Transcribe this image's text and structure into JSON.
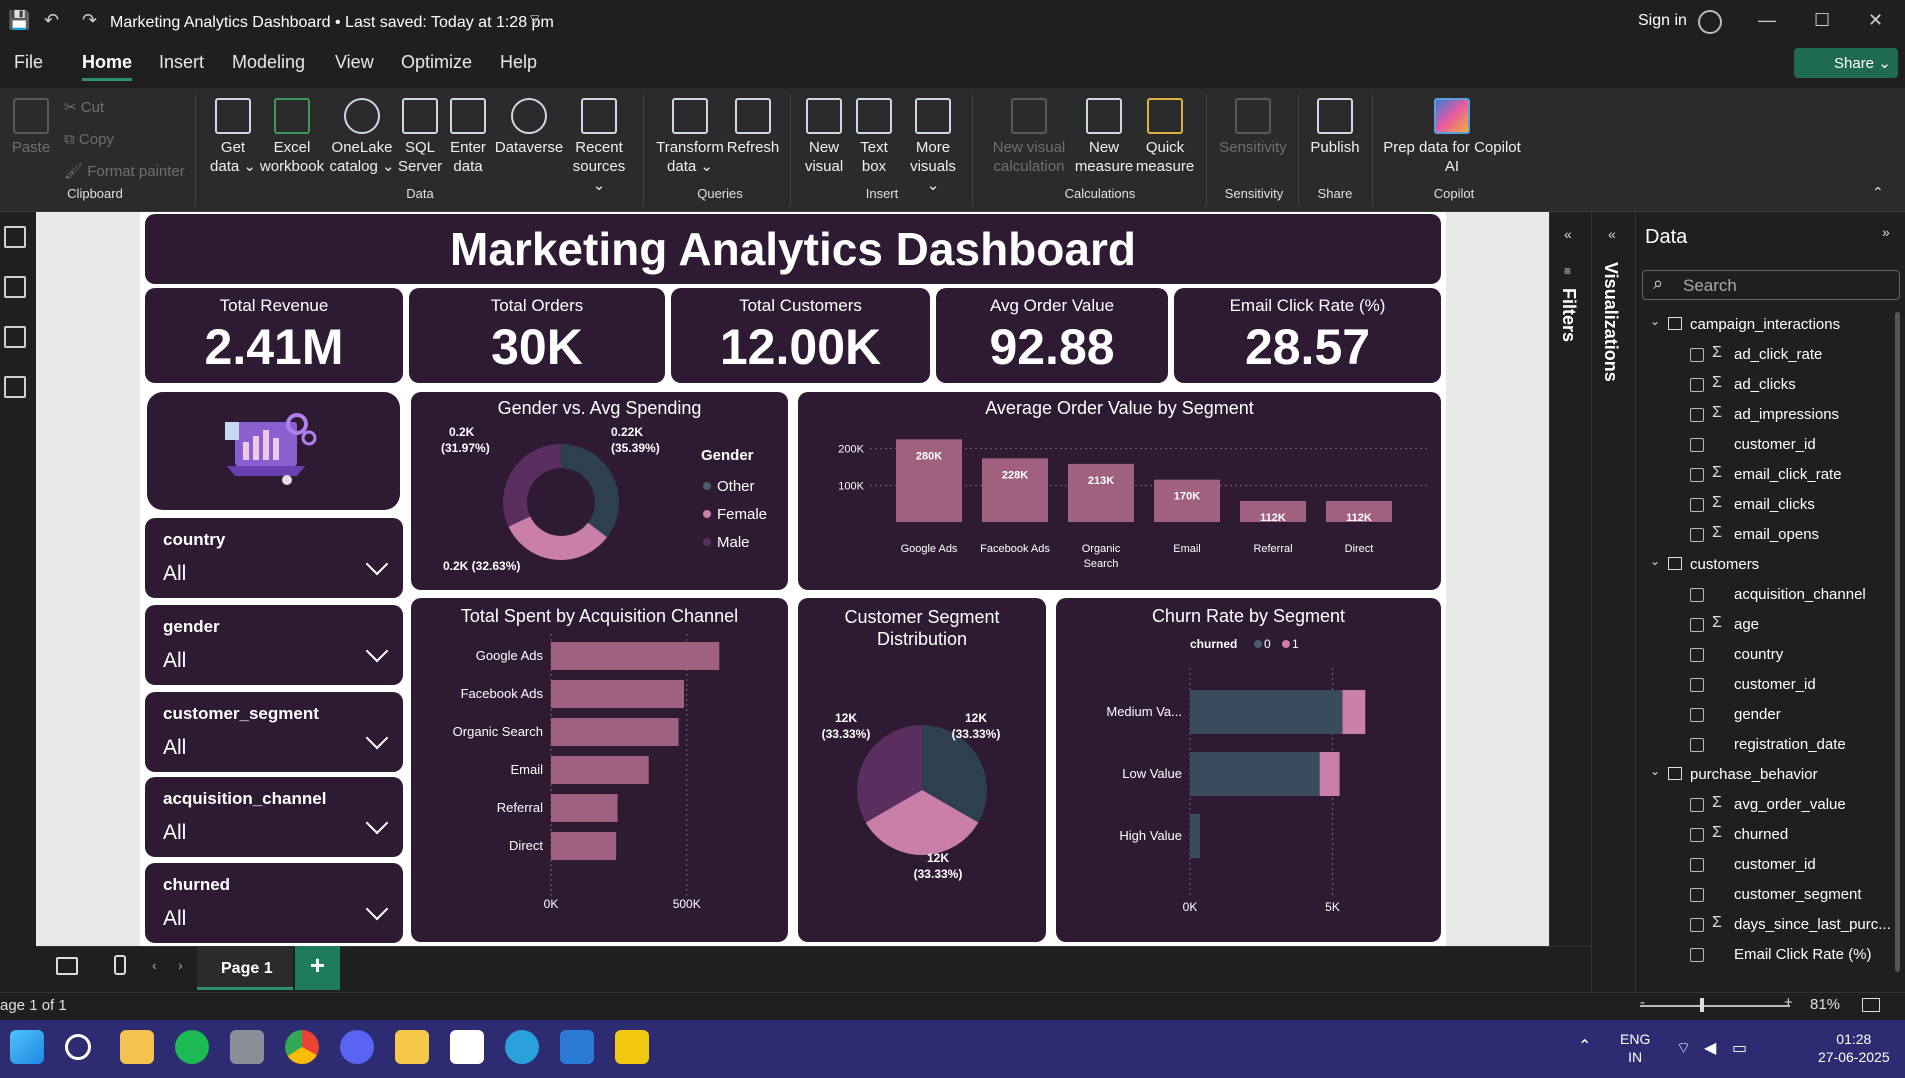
{
  "window": {
    "title": "Marketing Analytics Dashboard • Last saved: Today at 1:28 pm",
    "sign_in": "Sign in"
  },
  "menu": [
    "File",
    "Home",
    "Insert",
    "Modeling",
    "View",
    "Optimize",
    "Help"
  ],
  "share_label": "Share",
  "ribbon": {
    "clipboard": {
      "paste": "Paste",
      "cut": "Cut",
      "copy": "Copy",
      "format_painter": "Format painter",
      "group": "Clipboard"
    },
    "data": {
      "get_data": "Get data",
      "excel": "Excel workbook",
      "onelake": "OneLake catalog",
      "sql": "SQL Server",
      "enter": "Enter data",
      "dataverse": "Dataverse",
      "recent": "Recent sources",
      "group": "Data"
    },
    "queries": {
      "transform": "Transform data",
      "refresh": "Refresh",
      "group": "Queries"
    },
    "insert": {
      "new_visual": "New visual",
      "text_box": "Text box",
      "more_visuals": "More visuals",
      "group": "Insert"
    },
    "calculations": {
      "new_visual_calc": "New visual calculation",
      "new_measure": "New measure",
      "quick_measure": "Quick measure",
      "group": "Calculations"
    },
    "sensitivity": {
      "label": "Sensitivity",
      "group": "Sensitivity"
    },
    "share": {
      "publish": "Publish",
      "group": "Share"
    },
    "copilot": {
      "prep": "Prep data for Copilot AI",
      "copilot": "Copilot",
      "group": "Copilot"
    }
  },
  "report": {
    "title": "Marketing Analytics Dashboard",
    "kpis": [
      {
        "label": "Total Revenue",
        "value": "2.41M"
      },
      {
        "label": "Total Orders",
        "value": "30K"
      },
      {
        "label": "Total Customers",
        "value": "12.00K"
      },
      {
        "label": "Avg Order Value",
        "value": "92.88"
      },
      {
        "label": "Email Click Rate (%)",
        "value": "28.57"
      }
    ],
    "slicers": [
      {
        "label": "country",
        "value": "All"
      },
      {
        "label": "gender",
        "value": "All"
      },
      {
        "label": "customer_segment",
        "value": "All"
      },
      {
        "label": "acquisition_channel",
        "value": "All"
      },
      {
        "label": "churned",
        "value": "All"
      }
    ]
  },
  "colors": {
    "card": "#2e1a33",
    "pink": "#c97fa9",
    "dark_slate": "#2e3f4f",
    "plum": "#5a2e5e",
    "bar": "#a0607f"
  },
  "chart_data": [
    {
      "type": "pie",
      "title": "Gender vs. Avg Spending",
      "legend_title": "Gender",
      "legend_placement": "right",
      "slices": [
        {
          "name": "Other",
          "label": "0.22K",
          "pct": "(35.39%)",
          "value": 35.39,
          "color": "#2e3f4f"
        },
        {
          "name": "Female",
          "label": "0.2K",
          "pct": "(32.63%)",
          "value": 32.63,
          "color": "#c97fa9"
        },
        {
          "name": "Male",
          "label": "0.2K",
          "pct": "(31.97%)",
          "value": 31.97,
          "color": "#5a2e5e"
        }
      ],
      "donut": true
    },
    {
      "type": "bar",
      "title": "Average Order Value by Segment",
      "categories": [
        "Google Ads",
        "Facebook Ads",
        "Organic Search",
        "Email",
        "Referral",
        "Direct"
      ],
      "values": [
        280,
        228,
        213,
        170,
        112,
        112
      ],
      "data_labels": [
        "280K",
        "228K",
        "213K",
        "170K",
        "112K",
        "112K"
      ],
      "yticks": [
        "100K",
        "200K"
      ],
      "ylim": [
        0,
        300
      ]
    },
    {
      "type": "bar",
      "orientation": "horizontal",
      "title": "Total Spent by Acquisition Channel",
      "categories": [
        "Google Ads",
        "Facebook Ads",
        "Organic Search",
        "Email",
        "Referral",
        "Direct"
      ],
      "values": [
        620,
        490,
        470,
        360,
        245,
        240
      ],
      "xticks": [
        "0K",
        "500K"
      ],
      "xlim": [
        0,
        700
      ]
    },
    {
      "type": "pie",
      "title": "Customer Segment Distribution",
      "slices": [
        {
          "label": "12K",
          "pct": "(33.33%)",
          "value": 33.33,
          "color": "#2e3f4f"
        },
        {
          "label": "12K",
          "pct": "(33.33%)",
          "value": 33.33,
          "color": "#c97fa9"
        },
        {
          "label": "12K",
          "pct": "(33.33%)",
          "value": 33.33,
          "color": "#5a2e5e"
        }
      ]
    },
    {
      "type": "bar",
      "orientation": "horizontal",
      "stacked": true,
      "title": "Churn Rate by Segment",
      "legend_title": "churned",
      "legend_placement": "top",
      "categories": [
        "Medium Va...",
        "Low Value",
        "High Value"
      ],
      "series": [
        {
          "name": "0",
          "values": [
            5350,
            4550,
            350
          ],
          "color": "#2e3f4f"
        },
        {
          "name": "1",
          "values": [
            800,
            700,
            0
          ],
          "color": "#c97fa9"
        }
      ],
      "xticks": [
        "0K",
        "5K"
      ],
      "xlim": [
        0,
        8000
      ]
    }
  ],
  "panes": {
    "filters": "Filters",
    "visualizations": "Visualizations",
    "data": "Data",
    "search_placeholder": "Search"
  },
  "data_tree": [
    {
      "table": "campaign_interactions",
      "fields": [
        {
          "name": "ad_click_rate",
          "sigma": true
        },
        {
          "name": "ad_clicks",
          "sigma": true
        },
        {
          "name": "ad_impressions",
          "sigma": true
        },
        {
          "name": "customer_id",
          "sigma": false
        },
        {
          "name": "email_click_rate",
          "sigma": true
        },
        {
          "name": "email_clicks",
          "sigma": true
        },
        {
          "name": "email_opens",
          "sigma": true
        }
      ]
    },
    {
      "table": "customers",
      "fields": [
        {
          "name": "acquisition_channel",
          "sigma": false
        },
        {
          "name": "age",
          "sigma": true
        },
        {
          "name": "country",
          "sigma": false
        },
        {
          "name": "customer_id",
          "sigma": false
        },
        {
          "name": "gender",
          "sigma": false
        },
        {
          "name": "registration_date",
          "sigma": false
        }
      ]
    },
    {
      "table": "purchase_behavior",
      "fields": [
        {
          "name": "avg_order_value",
          "sigma": true
        },
        {
          "name": "churned",
          "sigma": true
        },
        {
          "name": "customer_id",
          "sigma": false
        },
        {
          "name": "customer_segment",
          "sigma": false
        },
        {
          "name": "days_since_last_purc...",
          "sigma": true
        },
        {
          "name": "Email Click Rate (%)",
          "sigma": false
        }
      ]
    }
  ],
  "page_tab": "Page 1",
  "status": {
    "page": "age 1 of 1",
    "zoom": "81%"
  },
  "tray": {
    "lang1": "ENG",
    "lang2": "IN",
    "time": "01:28",
    "date": "27-06-2025"
  }
}
